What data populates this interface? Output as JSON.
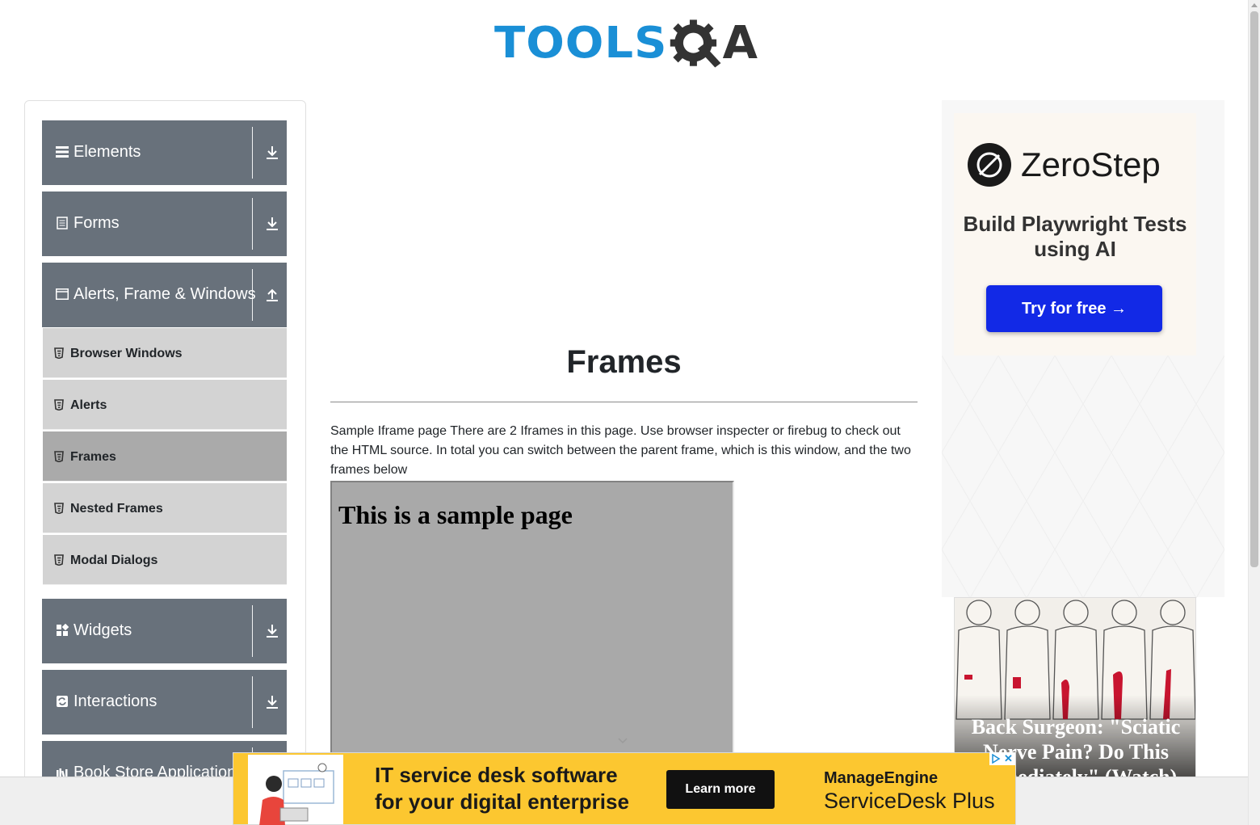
{
  "header": {
    "logo_text_tools": "TOOLS",
    "logo_text_a": "A",
    "brand_color": "#1a8fd6"
  },
  "sidebar": {
    "groups": [
      {
        "label": "Elements",
        "icon": "hamburger-icon",
        "toggle": "download-arrow-icon"
      },
      {
        "label": "Forms",
        "icon": "document-icon",
        "toggle": "download-arrow-icon"
      },
      {
        "label": "Alerts, Frame & Windows",
        "icon": "window-icon",
        "toggle": "upload-arrow-icon",
        "expanded": true,
        "items": [
          {
            "label": "Browser Windows",
            "active": false
          },
          {
            "label": "Alerts",
            "active": false
          },
          {
            "label": "Frames",
            "active": true
          },
          {
            "label": "Nested Frames",
            "active": false
          },
          {
            "label": "Modal Dialogs",
            "active": false
          }
        ]
      },
      {
        "label": "Widgets",
        "icon": "widgets-icon",
        "toggle": "download-arrow-icon"
      },
      {
        "label": "Interactions",
        "icon": "interactions-icon",
        "toggle": "download-arrow-icon"
      },
      {
        "label": "Book Store Application",
        "icon": "book-store-icon",
        "toggle": "download-arrow-icon"
      }
    ],
    "header_color": "#68717b",
    "item_color": "#d3d3d3",
    "active_item_color": "#aaaaaa"
  },
  "main": {
    "title": "Frames",
    "description": "Sample Iframe page There are 2 Iframes in this page. Use browser inspecter or firebug to check out the HTML source. In total you can switch between the parent frame, which is this window, and the two frames below",
    "frame1_heading": "This is a sample page"
  },
  "right_ads": {
    "zerostep": {
      "brand": "ZeroStep",
      "tagline": "Build Playwright Tests using AI",
      "button": "Try for free →",
      "button_color": "#1229e6"
    },
    "surgeon": {
      "headline": "Back Surgeon: \"Sciatic Nerve Pain? Do This Immediately\" (Watch)"
    }
  },
  "bottom_ad": {
    "headline": "IT service desk software for your digital enterprise",
    "button": "Learn more",
    "brand_me": "ManageEngine",
    "product": "ServiceDesk Plus",
    "background": "#fcc730"
  }
}
